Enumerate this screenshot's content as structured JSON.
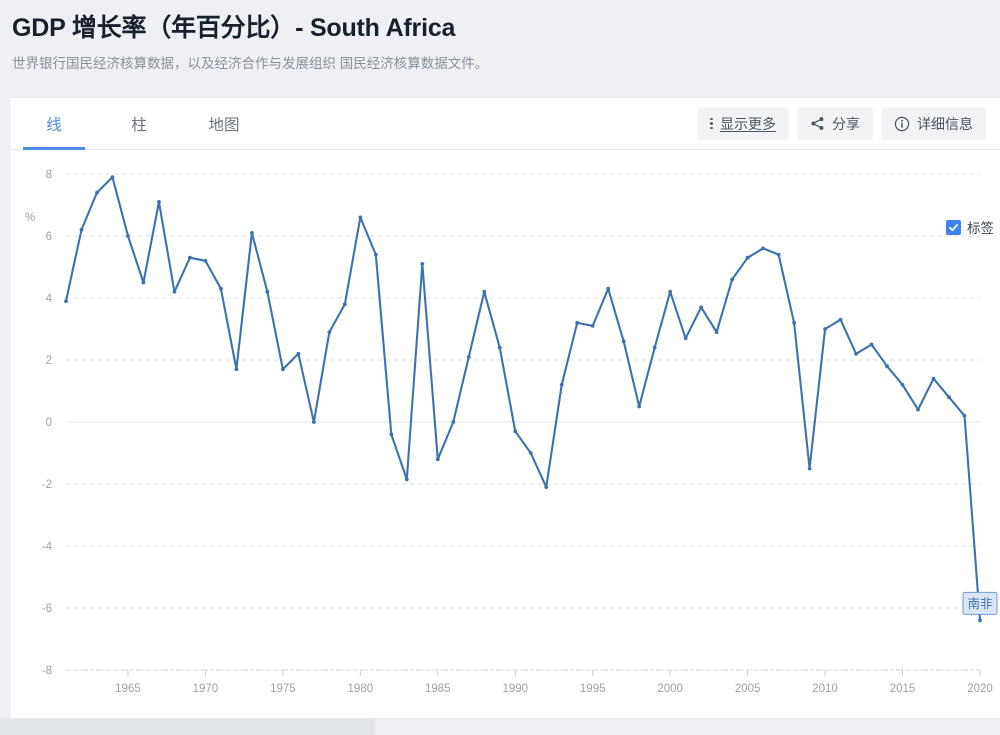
{
  "header": {
    "title": "GDP 增长率（年百分比）- South Africa",
    "subtitle": "世界银行国民经济核算数据，以及经济合作与发展组织 国民经济核算数据文件。"
  },
  "tabs": [
    {
      "label": "线",
      "active": true
    },
    {
      "label": "柱",
      "active": false
    },
    {
      "label": "地图",
      "active": false
    }
  ],
  "toolbar": {
    "more_label": "显示更多",
    "share_label": "分享",
    "details_label": "详细信息",
    "more_icon": "vertical-dots-icon",
    "share_icon": "share-icon",
    "details_icon": "info-circle-icon"
  },
  "legend": {
    "checkbox_label": "标签",
    "checked": true,
    "accent": "#3b82f6"
  },
  "colors": {
    "line": "#3f72ad",
    "accent": "#4a90e2",
    "grid": "#d9dde3",
    "zero_line": "#e3e6ea",
    "page_bg": "#eef0f4",
    "card_bg": "#ffffff"
  },
  "chart_data": {
    "type": "line",
    "title": "GDP 增长率（年百分比）- South Africa",
    "subtitle": "世界银行国民经济核算数据，以及经济合作与发展组织 国民经济核算数据文件。",
    "xlabel": "",
    "ylabel": "%",
    "unit": "%",
    "grid": true,
    "legend_position": "top-right",
    "xlim": [
      1961,
      2020
    ],
    "ylim": [
      -8,
      8
    ],
    "yticks": [
      8,
      6,
      4,
      2,
      0,
      -2,
      -4,
      -6,
      -8
    ],
    "xticks": [
      1965,
      1970,
      1975,
      1980,
      1985,
      1990,
      1995,
      2000,
      2005,
      2010,
      2015,
      2020
    ],
    "series": [
      {
        "name": "南非",
        "label": "南非",
        "color": "#3f72ad",
        "x": [
          1961,
          1962,
          1963,
          1964,
          1965,
          1966,
          1967,
          1968,
          1969,
          1970,
          1971,
          1972,
          1973,
          1974,
          1975,
          1976,
          1977,
          1978,
          1979,
          1980,
          1981,
          1982,
          1983,
          1984,
          1985,
          1986,
          1987,
          1988,
          1989,
          1990,
          1991,
          1992,
          1993,
          1994,
          1995,
          1996,
          1997,
          1998,
          1999,
          2000,
          2001,
          2002,
          2003,
          2004,
          2005,
          2006,
          2007,
          2008,
          2009,
          2010,
          2011,
          2012,
          2013,
          2014,
          2015,
          2016,
          2017,
          2018,
          2019,
          2020
        ],
        "values": [
          3.9,
          6.2,
          7.4,
          7.9,
          6.0,
          4.5,
          7.1,
          4.2,
          5.3,
          5.2,
          4.3,
          1.7,
          6.1,
          4.2,
          1.7,
          2.2,
          0.0,
          2.9,
          3.8,
          6.6,
          5.4,
          -0.4,
          -1.85,
          5.1,
          -1.2,
          0.0,
          2.1,
          4.2,
          2.4,
          -0.3,
          -1.0,
          -2.1,
          1.2,
          3.2,
          3.1,
          4.3,
          2.6,
          0.5,
          2.4,
          4.2,
          2.7,
          3.7,
          2.9,
          4.6,
          5.3,
          5.6,
          5.4,
          3.2,
          -1.5,
          3.0,
          3.3,
          2.2,
          2.5,
          1.8,
          1.2,
          0.4,
          1.4,
          0.8,
          0.2,
          -6.4
        ]
      }
    ]
  }
}
